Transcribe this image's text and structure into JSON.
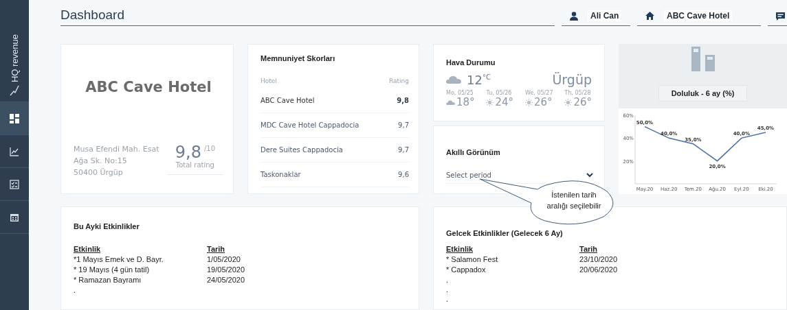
{
  "sidebar": {
    "brand": "HQ revenue",
    "items": [
      {
        "kind": "dashboard",
        "selected": true
      },
      {
        "kind": "chart",
        "selected": false
      },
      {
        "kind": "checklist",
        "selected": false
      },
      {
        "kind": "calendar",
        "selected": false
      }
    ]
  },
  "header": {
    "title": "Dashboard",
    "user": "Ali Can",
    "hotel": "ABC Cave Hotel"
  },
  "hotel_card": {
    "name": "ABC Cave Hotel",
    "address": [
      "Musa Efendi Mah. Esat",
      "Ağa Sk. No:15",
      "50400 Ürgüp"
    ],
    "rating": "9,8",
    "rating_max": "/10",
    "rating_label": "Total rating"
  },
  "scores": {
    "title": "Memnuniyet Skorları",
    "columns": [
      "Hotel",
      "Rating"
    ],
    "rows": [
      {
        "hotel": "ABC Cave Hotel",
        "rating": "9,8",
        "selected": true
      },
      {
        "hotel": "MDC Cave Hotel Cappadocia",
        "rating": "9,7",
        "selected": false
      },
      {
        "hotel": "Dere Suites Cappadocia",
        "rating": "9,7",
        "selected": false
      },
      {
        "hotel": "Taskonaklar",
        "rating": "9,6",
        "selected": false
      }
    ]
  },
  "weather": {
    "title": "Hava Durumu",
    "temp": "12",
    "unit": "°C",
    "city": "Ürgüp",
    "forecast": [
      {
        "day": "Mo, 05/25",
        "temp": "18°",
        "kind": "cloud"
      },
      {
        "day": "Tu, 05/26",
        "temp": "24°",
        "kind": "sun"
      },
      {
        "day": "We, 05/27",
        "temp": "26°",
        "kind": "sun"
      },
      {
        "day": "Th, 05/28",
        "temp": "26°",
        "kind": "sun"
      }
    ]
  },
  "smart_view": {
    "title": "Akıllı Görünüm",
    "placeholder": "Select period"
  },
  "callout": {
    "lines": [
      "İstenilen tarih",
      "aralığı seçilebilir"
    ]
  },
  "occupancy": {
    "title": "Doluluk - 6 ay (%)",
    "chart_data": {
      "type": "line",
      "categories": [
        "May.20",
        "Haz.20",
        "Tem.20",
        "Ağu.20",
        "Eyl.20",
        "Eki.20"
      ],
      "series": [
        {
          "color": "#4a6fa5",
          "values": [
            50,
            40,
            35,
            20,
            40,
            45
          ]
        }
      ],
      "ylim": [
        0,
        60
      ],
      "yticks": [
        {
          "value": 20,
          "label": "20%"
        },
        {
          "value": 40,
          "label": "40%"
        },
        {
          "value": 60,
          "label": "60%"
        }
      ],
      "value_labels": [
        "50,0%",
        "40,0%",
        "35,0%",
        "20,0%",
        "40,0%",
        "45,0%"
      ]
    }
  },
  "this_month": {
    "title": "Bu Ayki Etkinlikler",
    "columns": [
      "Etkinlik",
      "Tarih"
    ],
    "rows": [
      {
        "event": "*1 Mayıs Emek ve D. Bayr.",
        "date": "1/05/2020"
      },
      {
        "event": "* 19 Mayıs (4 gün tatil)",
        "date": "19/05/2020"
      },
      {
        "event": "* Ramazan Bayramı",
        "date": "24/05/2020"
      }
    ],
    "trailing": [
      "."
    ]
  },
  "upcoming": {
    "title": "Gelcek Etkinlikler (Gelecek 6 Ay)",
    "columns": [
      "Etkinlik",
      "Tarih"
    ],
    "rows": [
      {
        "event": "* Salamon Fest",
        "date": "23/10/2020"
      },
      {
        "event": "* Cappadox",
        "date": "20/06/2020"
      }
    ],
    "trailing": [
      ".",
      ".",
      "."
    ]
  }
}
